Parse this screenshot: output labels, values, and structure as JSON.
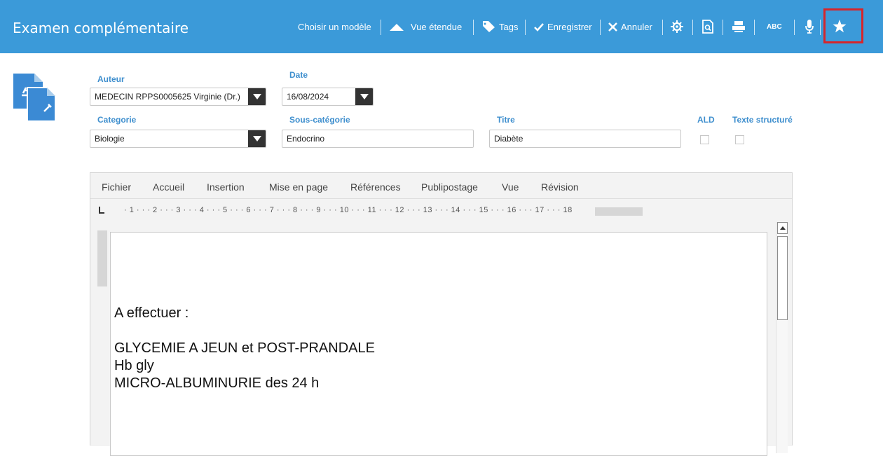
{
  "header": {
    "title": "Examen complémentaire",
    "toolbar": {
      "choose_model": "Choisir un modèle",
      "extended_view": "Vue étendue",
      "tags": "Tags",
      "save": "Enregistrer",
      "cancel": "Annuler",
      "spellcheck": "ABC"
    }
  },
  "form": {
    "author_label": "Auteur",
    "author_value": "MEDECIN RPPS0005625 Virginie (Dr.)",
    "date_label": "Date",
    "date_value": "16/08/2024",
    "category_label": "Categorie",
    "category_value": "Biologie",
    "subcategory_label": "Sous-catégorie",
    "subcategory_value": "Endocrino",
    "title_label": "Titre",
    "title_value": "Diabète",
    "ald_label": "ALD",
    "structured_label": "Texte structuré"
  },
  "editor": {
    "menu": [
      "Fichier",
      "Accueil",
      "Insertion",
      "Mise en page",
      "Références",
      "Publipostage",
      "Vue",
      "Révision"
    ],
    "ruler_marks": "· 1 · · · 2 · · · 3 · · · 4 · · · 5 · · · 6 · · · 7 · · · 8 · · · 9 · · · 10 · · · 11 · · · 12 · · · 13 · · · 14 · · · 15 · · · 16 · · · 17 · · · 18",
    "content": {
      "line1": "A effectuer :",
      "line2": "GLYCEMIE A JEUN et POST-PRANDALE",
      "line3": "Hb gly",
      "line4": "MICRO-ALBUMINURIE des 24 h"
    }
  },
  "colors": {
    "header_bg": "#3b9ad9",
    "label": "#3f8fce",
    "highlight": "#d6252b"
  }
}
